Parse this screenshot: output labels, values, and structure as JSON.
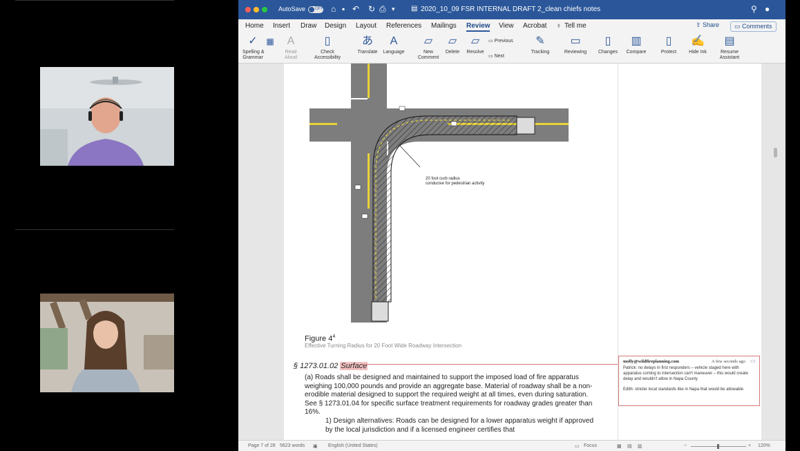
{
  "titlebar": {
    "autosave_label": "AutoSave",
    "autosave_state": "OFF",
    "document_title": "2020_10_09 FSR INTERNAL DRAFT 2_clean chiefs notes",
    "quick_access": [
      "home-icon",
      "save-icon",
      "undo-icon",
      "redo-icon",
      "print-icon",
      "customize-icon"
    ]
  },
  "menu": {
    "items": [
      "Home",
      "Insert",
      "Draw",
      "Design",
      "Layout",
      "References",
      "Mailings",
      "Review",
      "View",
      "Acrobat"
    ],
    "active": "Review",
    "tell_me": "Tell me",
    "share": "Share",
    "comments": "Comments"
  },
  "ribbon": {
    "spelling": "Spelling &\nGrammar",
    "read_aloud": "Read\nAloud",
    "check_accessibility": "Check\nAccessibility",
    "translate": "Translate",
    "language": "Language",
    "new_comment": "New\nComment",
    "delete": "Delete",
    "resolve": "Resolve",
    "previous": "Previous",
    "next": "Next",
    "tracking": "Tracking",
    "reviewing": "Reviewing",
    "changes": "Changes",
    "compare": "Compare",
    "protect": "Protect",
    "hide_ink": "Hide Ink",
    "resume_assistant": "Resume\nAssistant"
  },
  "document": {
    "figure_annotation": "20 foot curb radius\nconducive for pedestrian activity",
    "figure_caption": "Figure 4",
    "figure_caption_sup": "4",
    "figure_subtitle": "Effective Turning Radius for 20 Foot Wide Roadway Intersection",
    "section_number": "§ 1273.01.02",
    "section_title": "Surface",
    "paragraph_a": "(a) Roads shall be designed and maintained to support the imposed load of fire apparatus weighing 100,000 pounds and provide an aggregate base. Material of roadway shall be a non-erodible material designed to support the required weight at all times, even during saturation. See § 1273.01.04 for specific surface treatment requirements for roadway grades greater than 16%.",
    "paragraph_1": "1) Design alternatives: Roads can be designed for a lower apparatus weight if approved by the local jurisdiction and if a licensed engineer certifies that"
  },
  "comment": {
    "author": "molly@wildfireplanning.com",
    "time": "A few seconds ago",
    "text_1": "Patrick: no delays in first responders – vehicle staged here with apparatus coming to intersection can't maneuver – this would create delay and wouldn't allow in Napa County",
    "text_2": "Edith: stricter local standards like in Napa that would be allowable"
  },
  "statusbar": {
    "page": "Page 7 of 28",
    "words": "5623 words",
    "language": "English (United States)",
    "focus": "Focus",
    "zoom": "120%"
  },
  "colors": {
    "word_blue": "#2b579a",
    "road_gray": "#7d7d7d",
    "lane_yellow": "#e8d33a",
    "comment_red": "#d47979"
  }
}
